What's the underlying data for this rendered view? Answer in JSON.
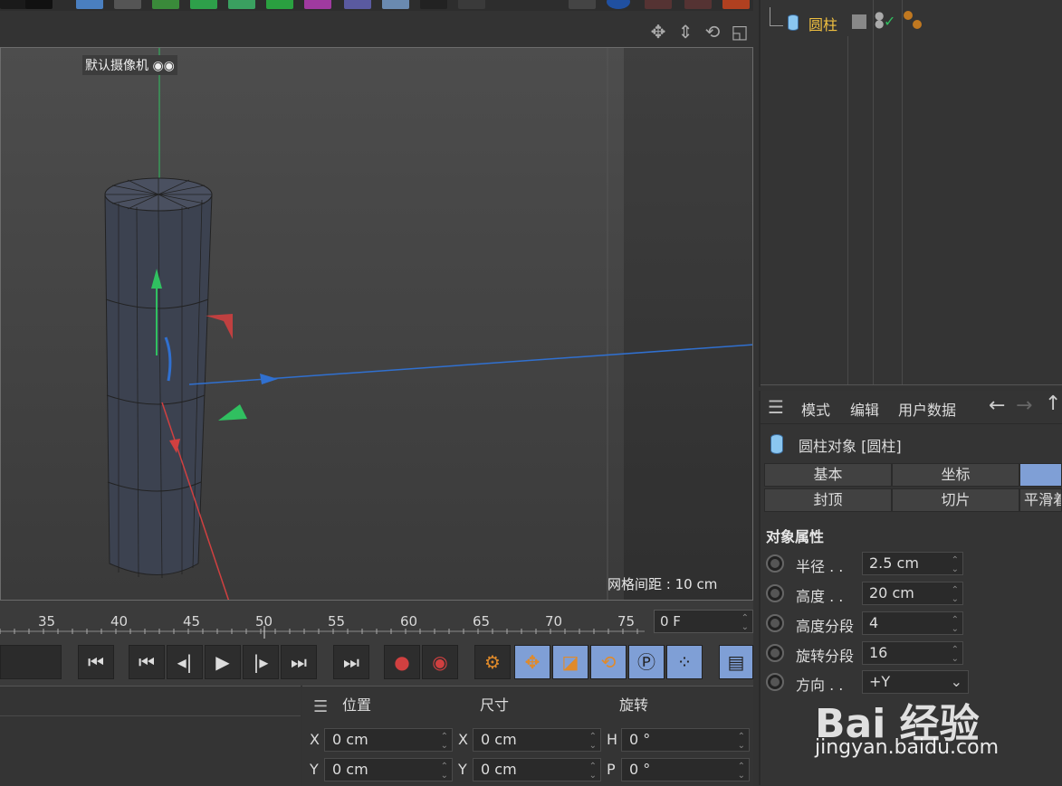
{
  "viewport": {
    "camera_label": "默认摄像机",
    "grid_spacing": "网格间距 : 10 cm"
  },
  "timeline": {
    "ticks": [
      "35",
      "40",
      "45",
      "50",
      "55",
      "60",
      "65",
      "70",
      "75"
    ],
    "current_frame": "0 F"
  },
  "object_manager": {
    "object_name": "圆柱"
  },
  "attributes": {
    "menu": [
      "模式",
      "编辑",
      "用户数据"
    ],
    "object_title": "圆柱对象 [圆柱]",
    "tabs_row1": [
      "基本",
      "坐标",
      ""
    ],
    "tabs_row2": [
      "封顶",
      "切片",
      "平滑着"
    ],
    "section_title": "对象属性",
    "properties": [
      {
        "label": "半径 . .",
        "value": "2.5 cm"
      },
      {
        "label": "高度 . .",
        "value": "20 cm"
      },
      {
        "label": "高度分段",
        "value": "4"
      },
      {
        "label": "旋转分段",
        "value": "16"
      },
      {
        "label": "方向 . .",
        "value": "+Y"
      }
    ]
  },
  "coordinates": {
    "headers": [
      "位置",
      "尺寸",
      "旋转"
    ],
    "rows": [
      {
        "pos_axis": "X",
        "pos": "0 cm",
        "size_axis": "X",
        "size": "0 cm",
        "rot_axis": "H",
        "rot": "0 °"
      },
      {
        "pos_axis": "Y",
        "pos": "0 cm",
        "size_axis": "Y",
        "size": "0 cm",
        "rot_axis": "P",
        "rot": "0 °"
      }
    ]
  },
  "watermark": {
    "brand": "Bai 经验",
    "url": "jingyan.baidu.com"
  },
  "colors": {
    "accent_blue": "#7f9fd6",
    "object_name": "#f0c040",
    "axis_x": "#d04040",
    "axis_y": "#30c060",
    "axis_z": "#3070d0"
  }
}
